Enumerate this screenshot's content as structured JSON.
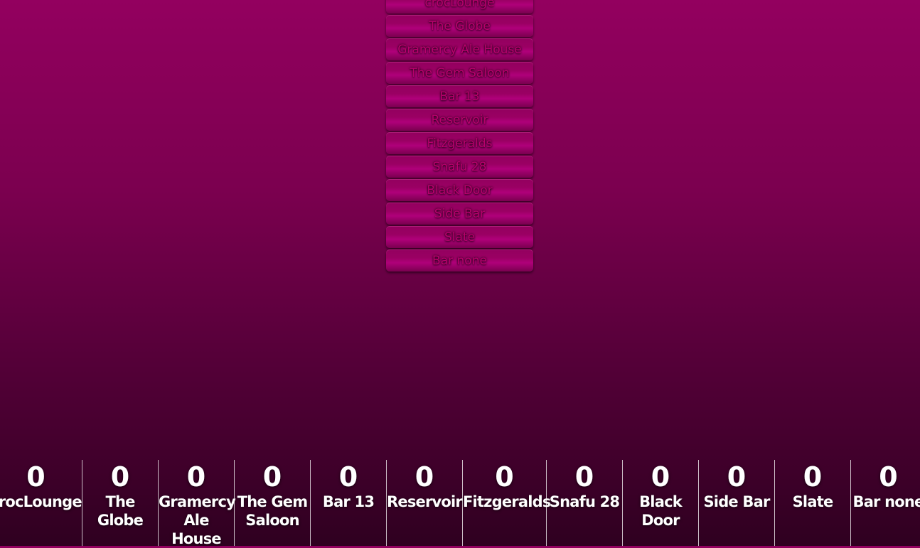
{
  "bars": [
    {
      "name": "crocLounge",
      "count": "0"
    },
    {
      "name": "The Globe",
      "count": "0"
    },
    {
      "name": "Gramercy Ale House",
      "count": "0"
    },
    {
      "name": "The Gem Saloon",
      "count": "0"
    },
    {
      "name": "Bar 13",
      "count": "0"
    },
    {
      "name": "Reservoir",
      "count": "0"
    },
    {
      "name": "Fitzgeralds",
      "count": "0"
    },
    {
      "name": "Snafu 28",
      "count": "0"
    },
    {
      "name": "Black Door",
      "count": "0"
    },
    {
      "name": "Side Bar",
      "count": "0"
    },
    {
      "name": "Slate",
      "count": "0"
    },
    {
      "name": "Bar none",
      "count": "0"
    }
  ],
  "colors": {
    "background_top": "#93005f",
    "background_bottom": "#2f0020",
    "button_text": "#b8006d",
    "scoreboard_text": "#ffffff"
  }
}
